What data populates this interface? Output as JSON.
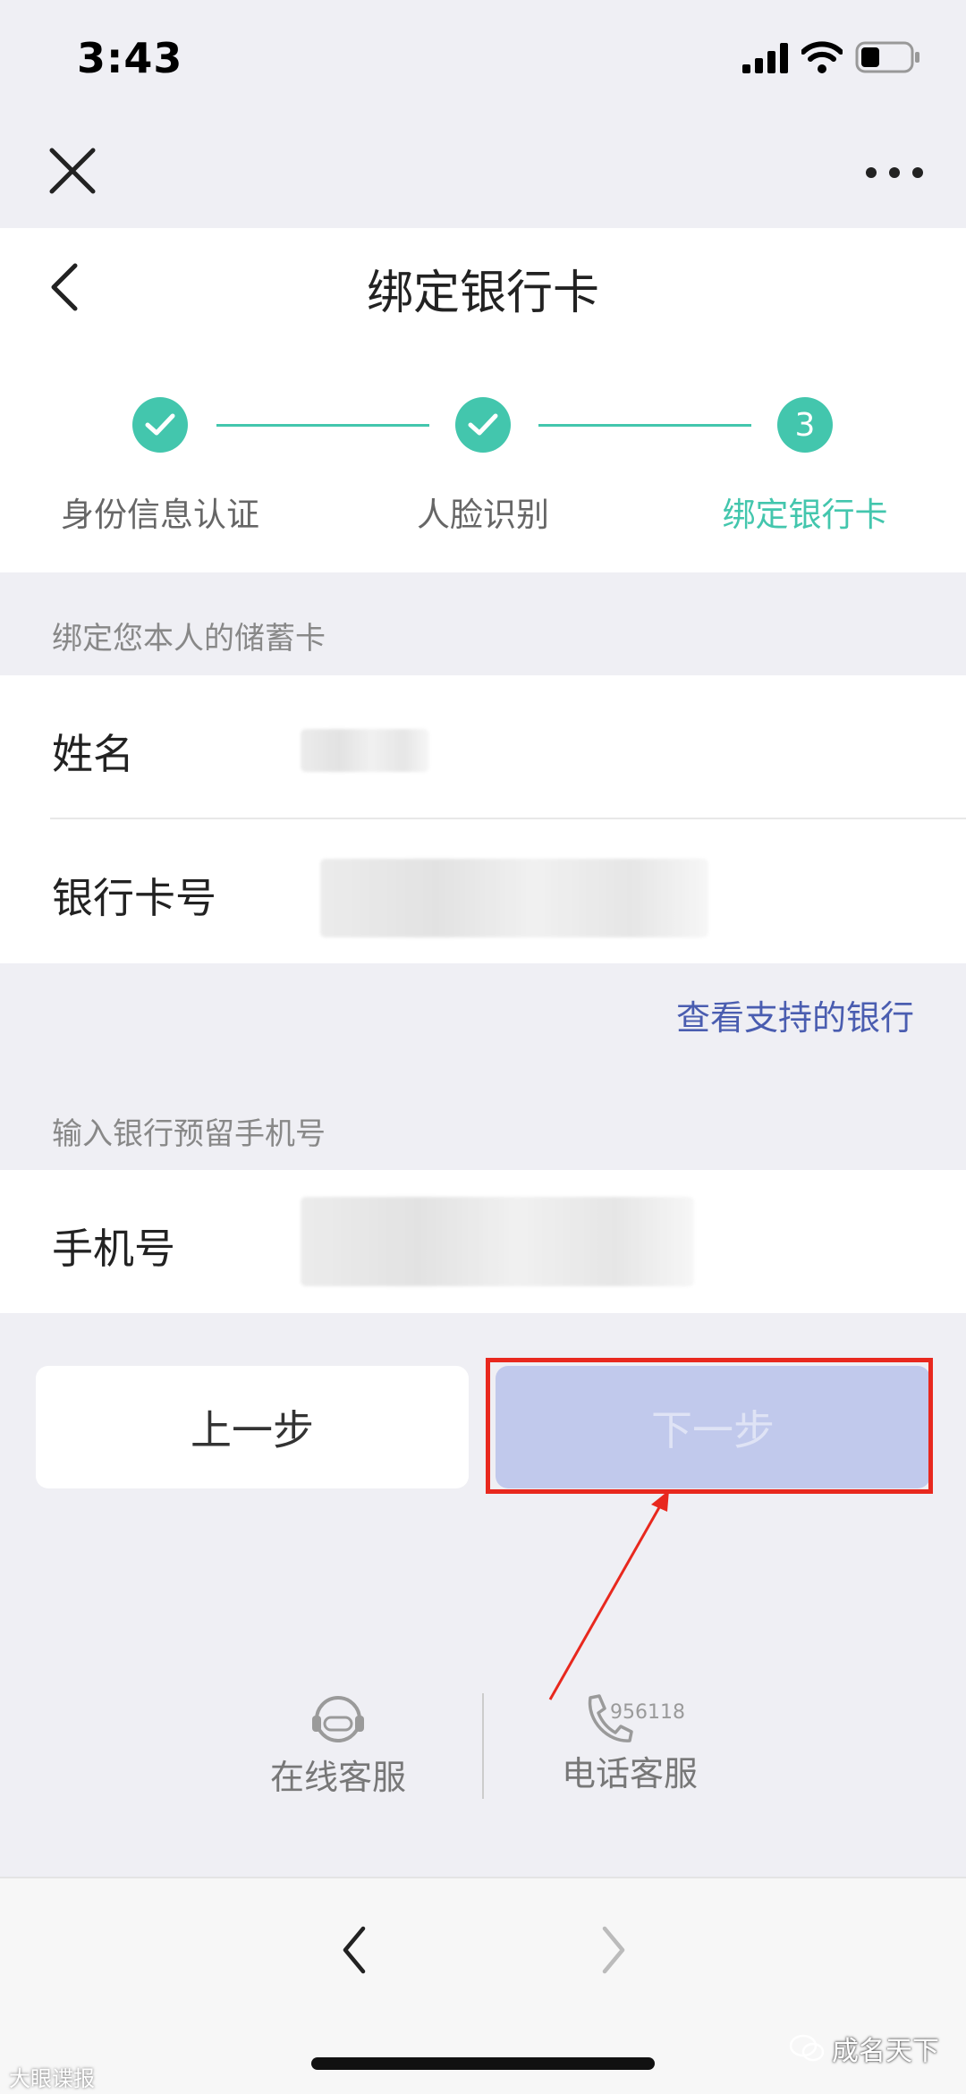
{
  "status": {
    "time": "3:43"
  },
  "header": {
    "title": "绑定银行卡"
  },
  "steps": [
    {
      "label": "身份信息认证",
      "state": "done"
    },
    {
      "label": "人脸识别",
      "state": "done"
    },
    {
      "label": "绑定银行卡",
      "state": "active",
      "number": "3"
    }
  ],
  "card_section": {
    "heading": "绑定您本人的储蓄卡",
    "name_label": "姓名",
    "card_label": "银行卡号",
    "support_link": "查看支持的银行"
  },
  "phone_section": {
    "heading": "输入银行预留手机号",
    "phone_label": "手机号"
  },
  "buttons": {
    "prev": "上一步",
    "next": "下一步"
  },
  "service": {
    "online_label": "在线客服",
    "phone_label": "电话客服",
    "phone_number": "956118"
  },
  "watermark": {
    "right": "成名天下",
    "left": "大眼谍报"
  },
  "colors": {
    "accent": "#43c6ad",
    "link": "#4a5db0",
    "next_disabled": "#c1c9ec",
    "highlight": "#e8281e"
  }
}
